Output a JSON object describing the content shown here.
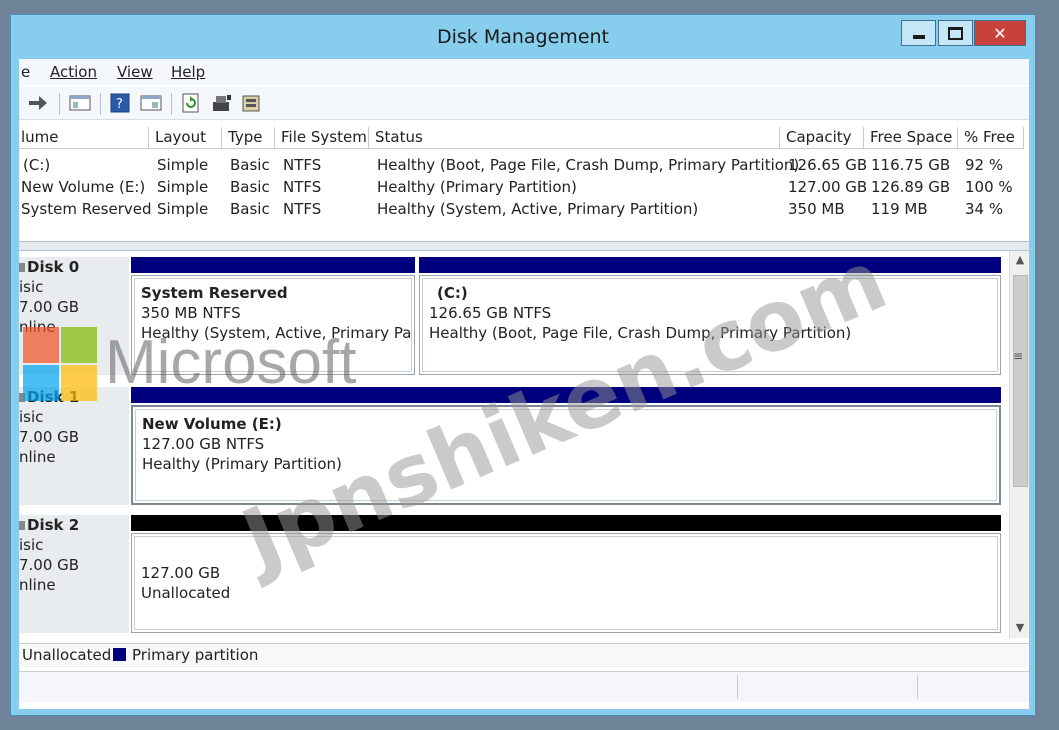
{
  "window": {
    "title": "Disk Management"
  },
  "menu": [
    {
      "label": "e"
    },
    {
      "label": "Action"
    },
    {
      "label": "View"
    },
    {
      "label": "Help"
    }
  ],
  "toolbar": {
    "icons": [
      "forward-arrow-icon",
      "properties-icon",
      "help-icon",
      "console-icon",
      "refresh-icon",
      "rescan-icon",
      "settings-icon"
    ]
  },
  "volume_list": {
    "columns": [
      "lume",
      "Layout",
      "Type",
      "File System",
      "Status",
      "Capacity",
      "Free Space",
      "% Free"
    ],
    "rows": [
      [
        "(C:)",
        "Simple",
        "Basic",
        "NTFS",
        "Healthy (Boot, Page File, Crash Dump, Primary Partition)",
        "126.65 GB",
        "116.75 GB",
        "92 %"
      ],
      [
        "New Volume (E:)",
        "Simple",
        "Basic",
        "NTFS",
        "Healthy (Primary Partition)",
        "127.00 GB",
        "126.89 GB",
        "100 %"
      ],
      [
        "System Reserved",
        "Simple",
        "Basic",
        "NTFS",
        "Healthy (System, Active, Primary Partition)",
        "350 MB",
        "119 MB",
        "34 %"
      ]
    ]
  },
  "disks": [
    {
      "name": "Disk 0",
      "type": "isic",
      "size": "7.00 GB",
      "status": "nline",
      "partitions": [
        {
          "title": "System Reserved",
          "size": "350 MB NTFS",
          "status": "Healthy (System, Active, Primary Partit"
        },
        {
          "title": "(C:)",
          "size": "126.65 GB NTFS",
          "status": "Healthy (Boot, Page File, Crash Dump, Primary Partition)"
        }
      ]
    },
    {
      "name": "Disk 1",
      "type": "isic",
      "size": "7.00 GB",
      "status": "nline",
      "partitions": [
        {
          "title": "New Volume  (E:)",
          "size": "127.00 GB NTFS",
          "status": "Healthy (Primary Partition)"
        }
      ]
    },
    {
      "name": "Disk 2",
      "type": "isic",
      "size": "7.00 GB",
      "status": "nline",
      "partitions": [
        {
          "size": "127.00 GB",
          "status": "Unallocated"
        }
      ]
    }
  ],
  "legend": [
    {
      "label": "Unallocated",
      "color": "#000000"
    },
    {
      "label": "Primary partition",
      "color": "#00007f"
    }
  ],
  "colors": {
    "primary": "#00007f",
    "unallocated": "#000000",
    "title_bar": "#87cdee",
    "close_button": "#c8413a"
  },
  "watermark": {
    "brand": "Microsoft",
    "site": "Jpnshiken.com"
  }
}
